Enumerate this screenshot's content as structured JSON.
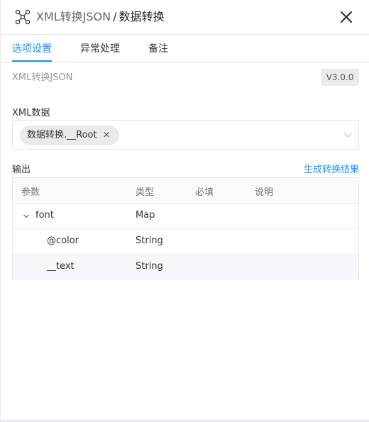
{
  "header": {
    "app_icon": "node-network-icon",
    "breadcrumb": "XML转换JSON",
    "separator": "/",
    "current": "数据转换",
    "close_icon": "close-icon"
  },
  "tabs": [
    {
      "label": "选项设置",
      "active": true
    },
    {
      "label": "异常处理",
      "active": false
    },
    {
      "label": "备注",
      "active": false
    }
  ],
  "component": {
    "name": "XML转换JSON",
    "version": "V3.0.0"
  },
  "xml_data": {
    "label": "XML数据",
    "selected_tag": "数据转换.__Root",
    "tag_close": "×"
  },
  "output": {
    "label": "输出",
    "generate_link": "生成转换结果",
    "columns": [
      "参数",
      "类型",
      "必填",
      "说明"
    ],
    "rows": [
      {
        "name": "font",
        "type": "Map",
        "required": "",
        "desc": "",
        "expanded": true
      },
      {
        "name": "@color",
        "type": "String",
        "required": "",
        "desc": ""
      },
      {
        "name": "__text",
        "type": "String",
        "required": "",
        "desc": ""
      }
    ]
  },
  "colors": {
    "accent": "#1890ff",
    "text": "#333333",
    "muted": "#999999"
  }
}
